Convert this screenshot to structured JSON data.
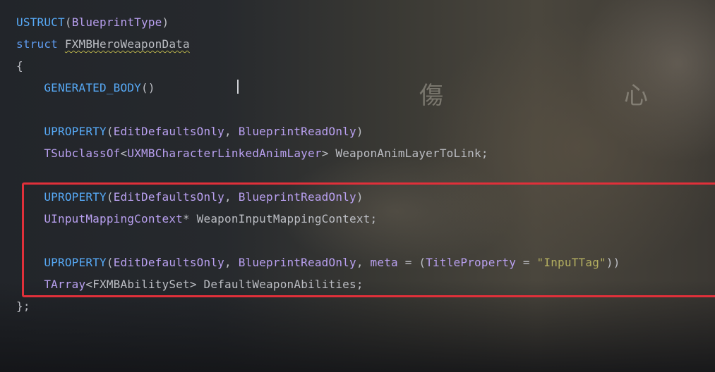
{
  "editor": {
    "lines": [
      {
        "tokens": [
          {
            "t": "USTRUCT",
            "c": "ustruct"
          },
          {
            "t": "(",
            "c": "ident"
          },
          {
            "t": "BlueprintType",
            "c": "bp-type"
          },
          {
            "t": ")",
            "c": "ident"
          }
        ]
      },
      {
        "tokens": [
          {
            "t": "struct",
            "c": "struct-kw"
          },
          {
            "t": " ",
            "c": "ident"
          },
          {
            "t": "FXMBHeroWeaponData",
            "c": "ident"
          }
        ]
      },
      {
        "tokens": [
          {
            "t": "{",
            "c": "ident"
          }
        ]
      },
      {
        "tokens": [
          {
            "t": "    ",
            "c": "ident"
          },
          {
            "t": "GENERATED_BODY",
            "c": "uprop"
          },
          {
            "t": "()",
            "c": "ident"
          }
        ]
      },
      {
        "tokens": []
      },
      {
        "tokens": [
          {
            "t": "    ",
            "c": "ident"
          },
          {
            "t": "UPROPERTY",
            "c": "uprop"
          },
          {
            "t": "(",
            "c": "ident"
          },
          {
            "t": "EditDefaultsOnly",
            "c": "typ"
          },
          {
            "t": ", ",
            "c": "ident"
          },
          {
            "t": "BlueprintReadOnly",
            "c": "typ"
          },
          {
            "t": ")",
            "c": "ident"
          }
        ]
      },
      {
        "tokens": [
          {
            "t": "    ",
            "c": "ident"
          },
          {
            "t": "TSubclassOf",
            "c": "typ"
          },
          {
            "t": "<",
            "c": "ident"
          },
          {
            "t": "UXMBCharacterLinkedAnimLayer",
            "c": "typ"
          },
          {
            "t": "> ",
            "c": "ident"
          },
          {
            "t": "WeaponAnimLayerToLink",
            "c": "ident"
          },
          {
            "t": ";",
            "c": "ident"
          }
        ]
      },
      {
        "tokens": []
      },
      {
        "tokens": [
          {
            "t": "    ",
            "c": "ident"
          },
          {
            "t": "UPROPERTY",
            "c": "uprop"
          },
          {
            "t": "(",
            "c": "ident"
          },
          {
            "t": "EditDefaultsOnly",
            "c": "typ"
          },
          {
            "t": ", ",
            "c": "ident"
          },
          {
            "t": "BlueprintReadOnly",
            "c": "typ"
          },
          {
            "t": ")",
            "c": "ident"
          }
        ]
      },
      {
        "tokens": [
          {
            "t": "    ",
            "c": "ident"
          },
          {
            "t": "UInputMappingContext",
            "c": "typ"
          },
          {
            "t": "* ",
            "c": "ident"
          },
          {
            "t": "WeaponInputMappingContext",
            "c": "ident"
          },
          {
            "t": ";",
            "c": "ident"
          }
        ]
      },
      {
        "tokens": []
      },
      {
        "tokens": [
          {
            "t": "    ",
            "c": "ident"
          },
          {
            "t": "UPROPERTY",
            "c": "uprop"
          },
          {
            "t": "(",
            "c": "ident"
          },
          {
            "t": "EditDefaultsOnly",
            "c": "typ"
          },
          {
            "t": ", ",
            "c": "ident"
          },
          {
            "t": "BlueprintReadOnly",
            "c": "typ"
          },
          {
            "t": ", ",
            "c": "ident"
          },
          {
            "t": "meta",
            "c": "typ"
          },
          {
            "t": " = (",
            "c": "ident"
          },
          {
            "t": "TitleProperty",
            "c": "typ"
          },
          {
            "t": " = ",
            "c": "ident"
          },
          {
            "t": "\"InpuTTag\"",
            "c": "macro"
          },
          {
            "t": "))",
            "c": "ident"
          }
        ]
      },
      {
        "tokens": [
          {
            "t": "    ",
            "c": "ident"
          },
          {
            "t": "TArray",
            "c": "typ"
          },
          {
            "t": "<",
            "c": "ident"
          },
          {
            "t": "FXMBAbilitySet",
            "c": "ident"
          },
          {
            "t": "> ",
            "c": "ident"
          },
          {
            "t": "DefaultWeaponAbilities",
            "c": "ident"
          },
          {
            "t": ";",
            "c": "ident"
          }
        ]
      },
      {
        "tokens": [
          {
            "t": "};",
            "c": "ident"
          }
        ]
      }
    ]
  },
  "background": {
    "glyph_left": "傷",
    "glyph_right": "心"
  },
  "colors": {
    "editor_bg": "#23262b",
    "highlight_border": "#e0303a",
    "keyword_blue": "#57aaf7",
    "type_purple": "#b9a0f0",
    "string_yellow": "#b3ae60",
    "default_text": "#bcbec4"
  }
}
